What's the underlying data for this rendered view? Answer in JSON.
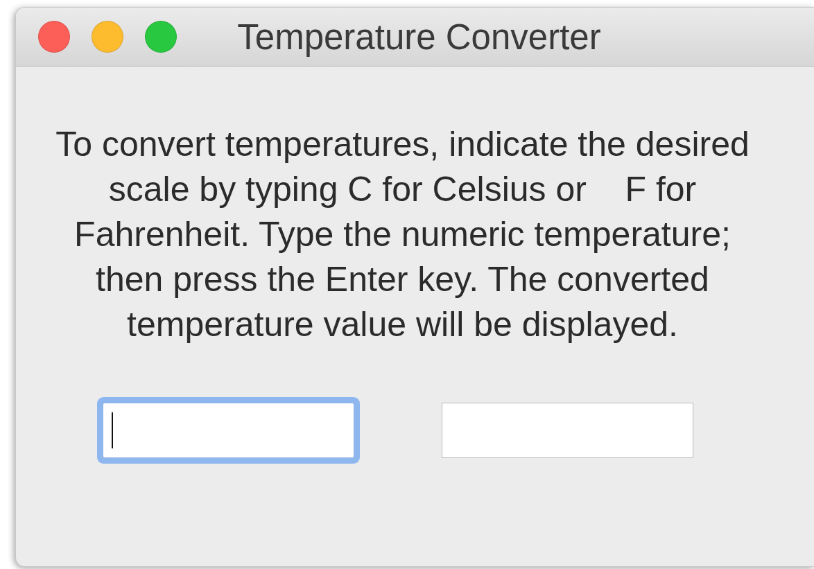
{
  "window": {
    "title": "Temperature Converter"
  },
  "instructions": "To convert temperatures, indicate the desired scale by typing C for Celsius or    F for Fahrenheit. Type the numeric temperature; then press the Enter key. The converted temperature value will be displayed.",
  "fields": [
    {
      "focused": true
    },
    {
      "focused": false
    }
  ]
}
